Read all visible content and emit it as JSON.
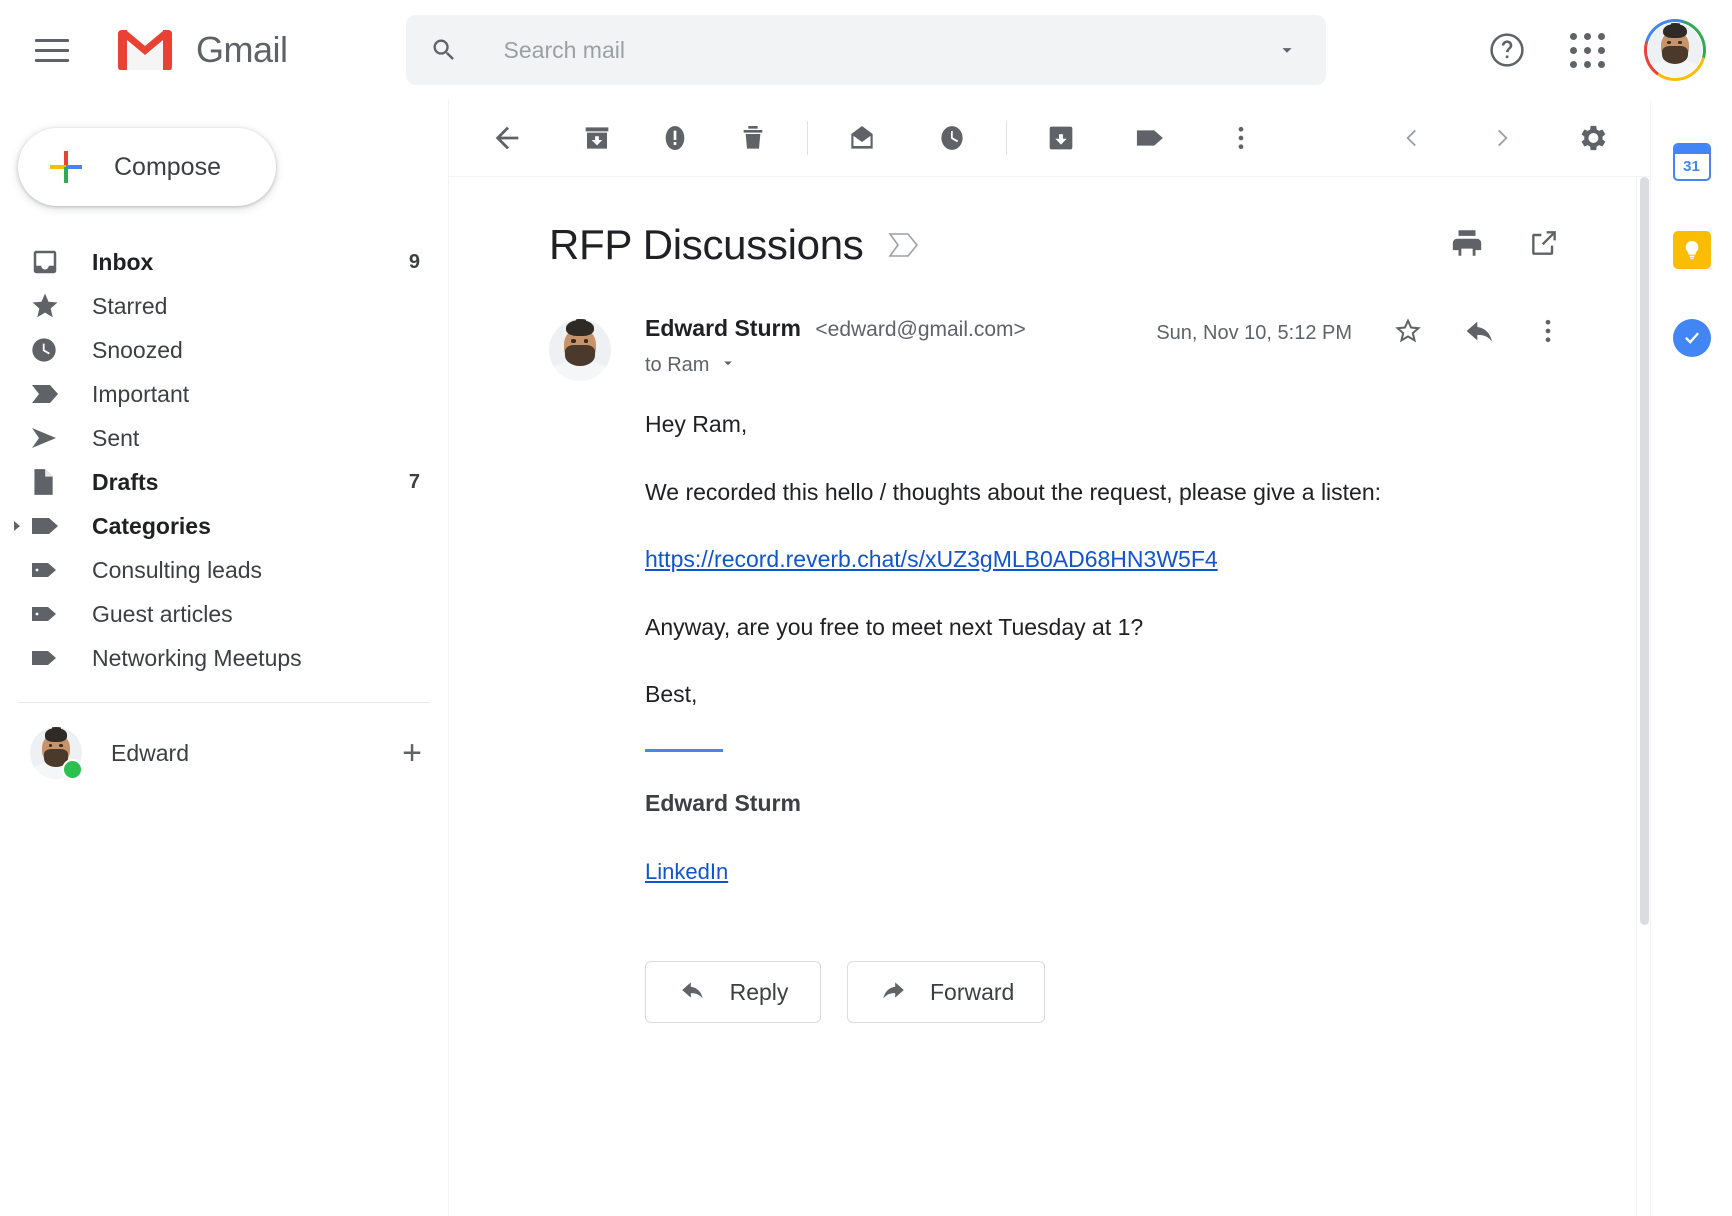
{
  "header": {
    "menu_icon": "hamburger-icon",
    "brand": "Gmail",
    "logo_icon": "gmail-m-logo",
    "search": {
      "icon": "search-icon",
      "placeholder": "Search mail",
      "value": "",
      "options_icon": "chevron-down-icon"
    },
    "help_icon": "help-circle-icon",
    "apps_icon": "apps-grid-icon",
    "avatar_icon": "account-avatar",
    "avatar_ring_colors": [
      "#ea4335",
      "#4285f4",
      "#34a853",
      "#fbbc05"
    ]
  },
  "sidebar": {
    "compose": {
      "label": "Compose",
      "icon": "plus-icon",
      "plus_colors": [
        "#ea4335",
        "#fbbc04",
        "#4285f4",
        "#34a853"
      ]
    },
    "items": [
      {
        "label": "Inbox",
        "icon": "inbox-icon",
        "count": "9",
        "bold": true
      },
      {
        "label": "Starred",
        "icon": "star-icon",
        "count": "",
        "bold": false
      },
      {
        "label": "Snoozed",
        "icon": "clock-icon",
        "count": "",
        "bold": false
      },
      {
        "label": "Important",
        "icon": "important-marker-icon",
        "count": "",
        "bold": false
      },
      {
        "label": "Sent",
        "icon": "send-icon",
        "count": "",
        "bold": false
      },
      {
        "label": "Drafts",
        "icon": "draft-page-icon",
        "count": "7",
        "bold": true
      },
      {
        "label": "Categories",
        "icon": "label-icon",
        "count": "",
        "bold": true,
        "twisty": "chevron-right-icon"
      },
      {
        "label": "Consulting leads",
        "icon": "label-outline-icon",
        "count": "",
        "bold": false
      },
      {
        "label": "Guest articles",
        "icon": "label-outline-icon",
        "count": "",
        "bold": false
      },
      {
        "label": "Networking Meetups",
        "icon": "label-icon",
        "count": "",
        "bold": false
      }
    ],
    "account": {
      "name": "Edward",
      "avatar_icon": "account-avatar",
      "status": "online",
      "status_color": "#2cc04e",
      "add_icon": "plus-icon"
    }
  },
  "toolbar": {
    "back_label": "Back to Inbox",
    "buttons": [
      {
        "name": "back-button",
        "icon": "arrow-left-icon"
      },
      {
        "name": "archive-button",
        "icon": "archive-icon"
      },
      {
        "name": "report-spam-button",
        "icon": "report-spam-icon"
      },
      {
        "name": "delete-button",
        "icon": "trash-icon"
      },
      {
        "name": "mark-unread-button",
        "icon": "mark-unread-icon"
      },
      {
        "name": "snooze-button",
        "icon": "clock-icon"
      },
      {
        "name": "add-to-tasks-button",
        "icon": "add-to-tasks-icon"
      },
      {
        "name": "labels-button",
        "icon": "label-icon"
      },
      {
        "name": "more-options-button",
        "icon": "more-vertical-icon"
      }
    ],
    "newer_icon": "chevron-left-icon",
    "older_icon": "chevron-right-icon",
    "settings_icon": "gear-icon"
  },
  "email": {
    "subject": "RFP Discussions",
    "subject_chip_icon": "inbox-label-icon",
    "print_icon": "printer-icon",
    "popout_icon": "open-in-new-icon",
    "sender_name": "Edward Sturm",
    "sender_email": "<edward@gmail.com>",
    "recipients": "to Ram",
    "recipients_caret_icon": "chevron-down-icon",
    "date": "Sun, Nov 10, 5:12 PM",
    "star_icon": "star-outline-icon",
    "reply_icon": "reply-arrow-icon",
    "more_icon": "more-vertical-icon",
    "body": {
      "greeting": "Hey Ram,",
      "paragraph1": "We recorded this hello / thoughts about the request, please give a listen:",
      "link": "https://record.reverb.chat/s/xUZ3gMLB0AD68HN3W5F4",
      "paragraph2": "Anyway, are you free to meet next Tuesday at 1?",
      "closing": "Best,",
      "signature_name": "Edward Sturm",
      "signature_link": "LinkedIn",
      "signature_rule_color": "#4a86e8",
      "link_color": "#1155cc"
    },
    "reply_button": {
      "label": "Reply",
      "icon": "reply-arrow-icon"
    },
    "forward_button": {
      "label": "Forward",
      "icon": "forward-arrow-icon"
    }
  },
  "right_rail": {
    "items": [
      {
        "name": "google-calendar-icon",
        "label": "31",
        "color": "#4285f4"
      },
      {
        "name": "google-keep-icon",
        "label": "",
        "color": "#fbbc04"
      },
      {
        "name": "google-tasks-icon",
        "label": "",
        "color": "#4285f4"
      }
    ]
  }
}
